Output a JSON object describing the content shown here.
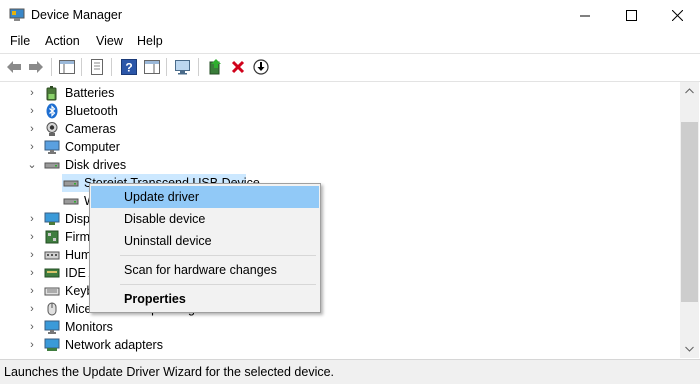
{
  "window": {
    "title": "Device Manager"
  },
  "menu": [
    "File",
    "Action",
    "View",
    "Help"
  ],
  "tree": {
    "items": [
      {
        "label": "Batteries",
        "icon": "battery-icon"
      },
      {
        "label": "Bluetooth",
        "icon": "bluetooth-icon"
      },
      {
        "label": "Cameras",
        "icon": "camera-icon"
      },
      {
        "label": "Computer",
        "icon": "computer-icon"
      },
      {
        "label": "Disk drives",
        "icon": "disk-drive-icon"
      },
      {
        "label": "Storejet Transcend USB Device",
        "icon": "disk-drive-icon"
      },
      {
        "label": "W",
        "icon": "disk-drive-icon"
      },
      {
        "label": "Disp",
        "icon": "display-icon"
      },
      {
        "label": "Firm",
        "icon": "firmware-icon"
      },
      {
        "label": "Hum",
        "icon": "hid-icon"
      },
      {
        "label": "IDE A",
        "icon": "ide-icon"
      },
      {
        "label": "Keyb",
        "icon": "keyboard-icon"
      },
      {
        "label": "Mice and other pointing devices",
        "icon": "mouse-icon"
      },
      {
        "label": "Monitors",
        "icon": "monitor-icon"
      },
      {
        "label": "Network adapters",
        "icon": "network-adapter-icon"
      }
    ]
  },
  "context_menu": {
    "update": "Update driver",
    "disable": "Disable device",
    "uninstall": "Uninstall device",
    "scan": "Scan for hardware changes",
    "properties": "Properties"
  },
  "status": "Launches the Update Driver Wizard for the selected device.",
  "colors": {
    "selection": "#cce8ff",
    "menu_highlight": "#91c9f7",
    "delete_red": "#d0021b"
  }
}
